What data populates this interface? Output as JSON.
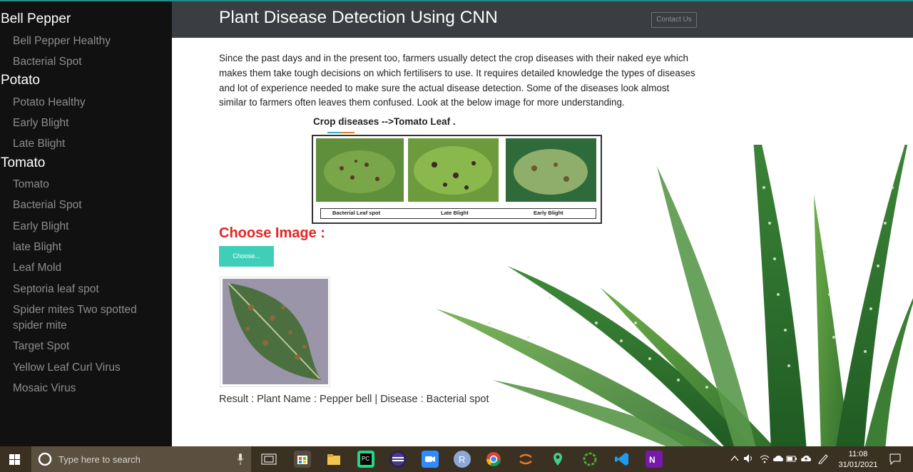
{
  "sidebar": {
    "categories": [
      {
        "label": "Bell Pepper",
        "items": [
          "Bell Pepper Healthy",
          "Bacterial Spot"
        ]
      },
      {
        "label": "Potato",
        "items": [
          "Potato Healthy",
          "Early Blight",
          "Late Blight"
        ]
      },
      {
        "label": "Tomato",
        "items": [
          "Tomato",
          "Bacterial Spot",
          "Early Blight",
          "late Blight",
          "Leaf Mold",
          "Septoria leaf spot",
          "Spider mites Two spotted spider mite",
          "Target Spot",
          "Yellow Leaf Curl Virus",
          "Mosaic Virus"
        ]
      }
    ]
  },
  "header": {
    "title": "Plant Disease Detection Using CNN",
    "contact_label": "Contact Us"
  },
  "main": {
    "description": "Since the past days and in the present too, farmers usually detect the crop diseases with their naked eye which makes them take tough decisions on which fertilisers to use. It requires detailed knowledge the types of diseases and lot of experience needed to make sure the actual disease detection. Some of the diseases look almost similar to farmers often leaves them confused. Look at the below image for more understanding.",
    "figure": {
      "title": "Crop diseases -->Tomato Leaf .",
      "captions": [
        "Bacterial Leaf spot",
        "Late Blight",
        "Early Blight"
      ]
    },
    "choose_label": "Choose Image :",
    "choose_button": "Choose...",
    "result": "Result : Plant Name : Pepper bell | Disease : Bacterial spot"
  },
  "taskbar": {
    "search_placeholder": "Type here to search",
    "time": "11:08",
    "date": "31/01/2021"
  },
  "colors": {
    "sidebar_bg": "#111111",
    "header_bg": "#3a3d42",
    "accent_button": "#3fcfb8",
    "choose_label": "#e82323"
  }
}
